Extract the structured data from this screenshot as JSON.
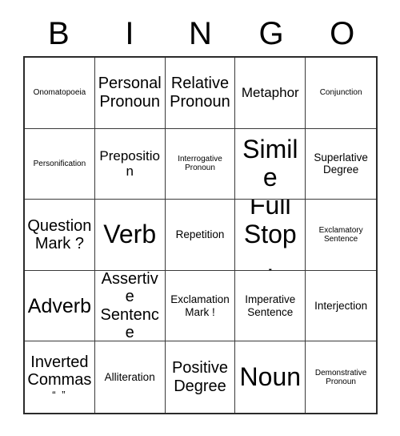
{
  "card": {
    "header_letters": [
      "B",
      "I",
      "N",
      "G",
      "O"
    ],
    "grid_size": "5x5",
    "colors": {
      "text": "#000000",
      "background": "#ffffff",
      "outer_border": "#2b2b2b",
      "inner_border": "#3a3a3a"
    },
    "rows": [
      [
        {
          "text": "Onomatopoeia",
          "size": "xs"
        },
        {
          "text": "Personal Pronoun",
          "size": "lg"
        },
        {
          "text": "Relative Pronoun",
          "size": "lg"
        },
        {
          "text": "Metaphor",
          "size": "md"
        },
        {
          "text": "Conjunction",
          "size": "xs"
        }
      ],
      [
        {
          "text": "Personification",
          "size": "xs"
        },
        {
          "text": "Preposition",
          "size": "md"
        },
        {
          "text": "Interrogative Pronoun",
          "size": "xs"
        },
        {
          "text": "Simile",
          "size": "xxl"
        },
        {
          "text": "Superlative Degree",
          "size": "sm"
        }
      ],
      [
        {
          "text": "Question Mark ?",
          "size": "lg"
        },
        {
          "text": "Verb",
          "size": "xxl"
        },
        {
          "text": "Repetition",
          "size": "sm"
        },
        {
          "text": "Full Stop .",
          "size": "xxl"
        },
        {
          "text": "Exclamatory Sentence",
          "size": "xs"
        }
      ],
      [
        {
          "text": "Adverb",
          "size": "xl"
        },
        {
          "text": "Assertive Sentence",
          "size": "lg"
        },
        {
          "text": "Exclamation Mark !",
          "size": "sm"
        },
        {
          "text": "Imperative Sentence",
          "size": "sm"
        },
        {
          "text": "Interjection",
          "size": "sm"
        }
      ],
      [
        {
          "text": "Inverted Commas",
          "size": "lg",
          "extra_line": "“ ”"
        },
        {
          "text": "Alliteration",
          "size": "sm"
        },
        {
          "text": "Positive Degree",
          "size": "lg"
        },
        {
          "text": "Noun",
          "size": "xxl"
        },
        {
          "text": "Demonstrative Pronoun",
          "size": "xs"
        }
      ]
    ]
  }
}
